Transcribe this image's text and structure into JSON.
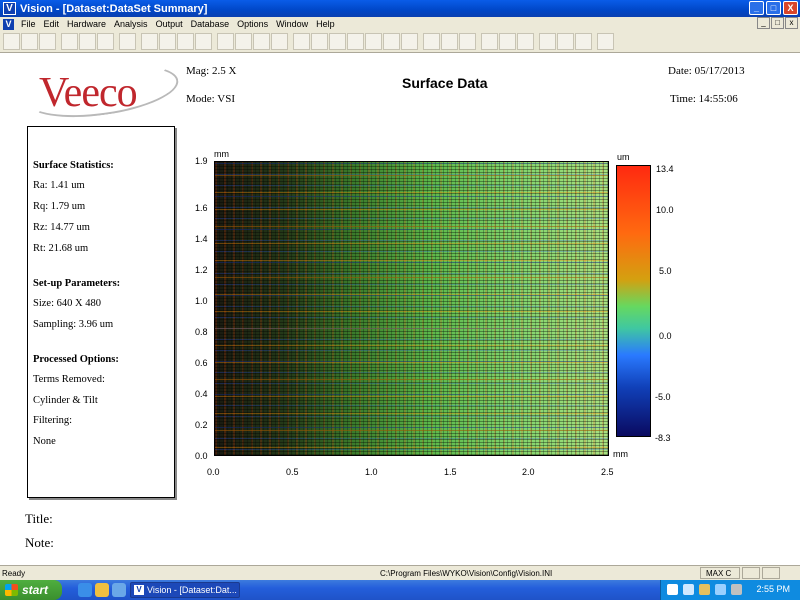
{
  "window": {
    "app_icon": "V",
    "title": "Vision - [Dataset:DataSet Summary]",
    "buttons": [
      "_",
      "□",
      "X"
    ]
  },
  "menu": {
    "items": [
      "File",
      "Edit",
      "Hardware",
      "Analysis",
      "Output",
      "Database",
      "Options",
      "Window",
      "Help"
    ],
    "mdi_buttons": [
      "_",
      "□",
      "x"
    ]
  },
  "header": {
    "logo_text": "Veeco",
    "mag": "Mag:  2.5 X",
    "mode": "Mode:  VSI",
    "title": "Surface Data",
    "date": "Date:  05/17/2013",
    "time": "Time:  14:55:06"
  },
  "stats": {
    "surface_heading": "Surface Statistics:",
    "ra": "Ra:  1.41 um",
    "rq": "Rq:  1.79 um",
    "rz": "Rz:  14.77 um",
    "rt": "Rt:  21.68 um",
    "setup_heading": "Set-up Parameters:",
    "size": "Size:  640 X 480",
    "sampling": "Sampling:  3.96 um",
    "processed_heading": "Processed Options:",
    "terms_removed": "Terms Removed:",
    "cylinder_tilt": "Cylinder & Tilt",
    "filtering": "Filtering:",
    "none": "None"
  },
  "notes": {
    "title_label": "Title:",
    "note_label": "Note:"
  },
  "plot": {
    "y_unit": "mm",
    "x_unit": "mm",
    "colorbar_unit": "um",
    "y_ticks": [
      "1.9",
      "1.6",
      "1.4",
      "1.2",
      "1.0",
      "0.8",
      "0.6",
      "0.4",
      "0.2",
      "0.0"
    ],
    "x_ticks": [
      "0.0",
      "0.5",
      "1.0",
      "1.5",
      "2.0",
      "2.5"
    ],
    "colorbar_ticks": [
      "13.4",
      "10.0",
      "5.0",
      "0.0",
      "-5.0",
      "-8.3"
    ]
  },
  "status": {
    "left": "Ready",
    "path": "C:\\Program Files\\WYKO\\Vision\\Config\\Vision.INI",
    "mode": "MAX C"
  },
  "taskbar": {
    "start": "start",
    "task_label": "Vision - [Dataset:Dat...",
    "task_icon": "V",
    "clock": "2:55 PM"
  }
}
